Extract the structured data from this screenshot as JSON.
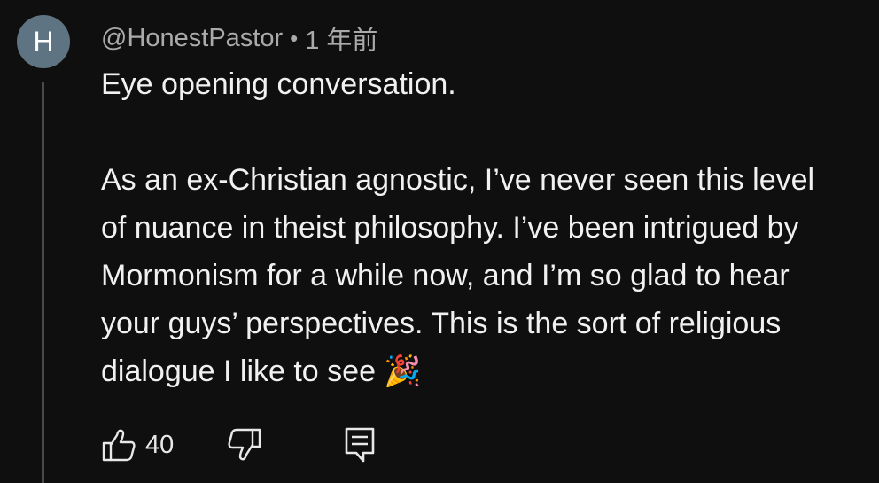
{
  "comment": {
    "avatar_letter": "H",
    "author": "@HonestPastor",
    "separator": "•",
    "time": "1 年前",
    "lines": [
      "Eye opening conversation.",
      "",
      "As an ex-Christian agnostic, I’ve never seen this level",
      "of nuance in theist philosophy. I’ve been intrigued by",
      "Mormonism for a while now, and I’m so glad to hear",
      "your guys’ perspectives. This is the sort of religious",
      "dialogue I like to see 🎉"
    ],
    "like_count": "40"
  },
  "icons": {
    "like": "thumbs-up-icon",
    "dislike": "thumbs-down-icon",
    "reply": "comment-reply-icon"
  },
  "colors": {
    "background": "#0f0f0f",
    "avatar": "#5f7483",
    "text": "#f1f1f1",
    "meta": "#aaaaaa"
  }
}
